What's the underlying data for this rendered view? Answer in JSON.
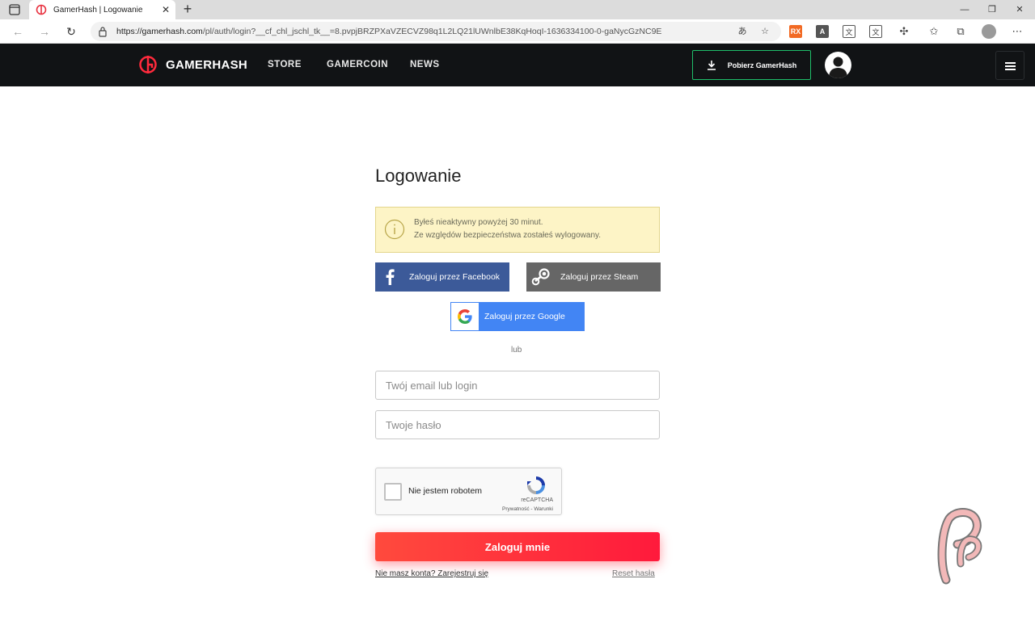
{
  "browser": {
    "tab_title": "GamerHash | Logowanie",
    "url_host": "https://gamerhash.com",
    "url_path": "/pl/auth/login?__cf_chl_jschl_tk__=8.pvpjBRZPXaVZECVZ98q1L2LQ21lUWnlbE38KqHoqI-1636334100-0-gaNycGzNC9E",
    "ext_rx": "RX",
    "ext_a": "A"
  },
  "header": {
    "logo_text": "GAMERHASH",
    "nav": [
      "STORE",
      "GAMERCOIN",
      "NEWS"
    ],
    "download_label": "Pobierz GamerHash"
  },
  "login": {
    "title": "Logowanie",
    "alert_line1": "Byłeś nieaktywny powyżej 30 minut.",
    "alert_line2": "Ze względów bezpieczeństwa zostałeś wylogowany.",
    "facebook_label": "Zaloguj przez Facebook",
    "steam_label": "Zaloguj przez Steam",
    "google_label": "Zaloguj przez Google",
    "or_label": "lub",
    "email_placeholder": "Twój email lub login",
    "password_placeholder": "Twoje hasło",
    "captcha_label": "Nie jestem robotem",
    "captcha_brand": "reCAPTCHA",
    "captcha_links": "Prywatność - Warunki",
    "submit_label": "Zaloguj mnie",
    "register_link": "Nie masz konta? Zarejestruj się",
    "reset_link": "Reset hasła"
  },
  "colors": {
    "header_bg": "#111315",
    "accent_red": "#ff2a3c",
    "download_border": "#1fbf6a",
    "facebook": "#3c5a99",
    "steam": "#666666",
    "google": "#4285f4",
    "alert_bg": "#fdf4c6"
  }
}
